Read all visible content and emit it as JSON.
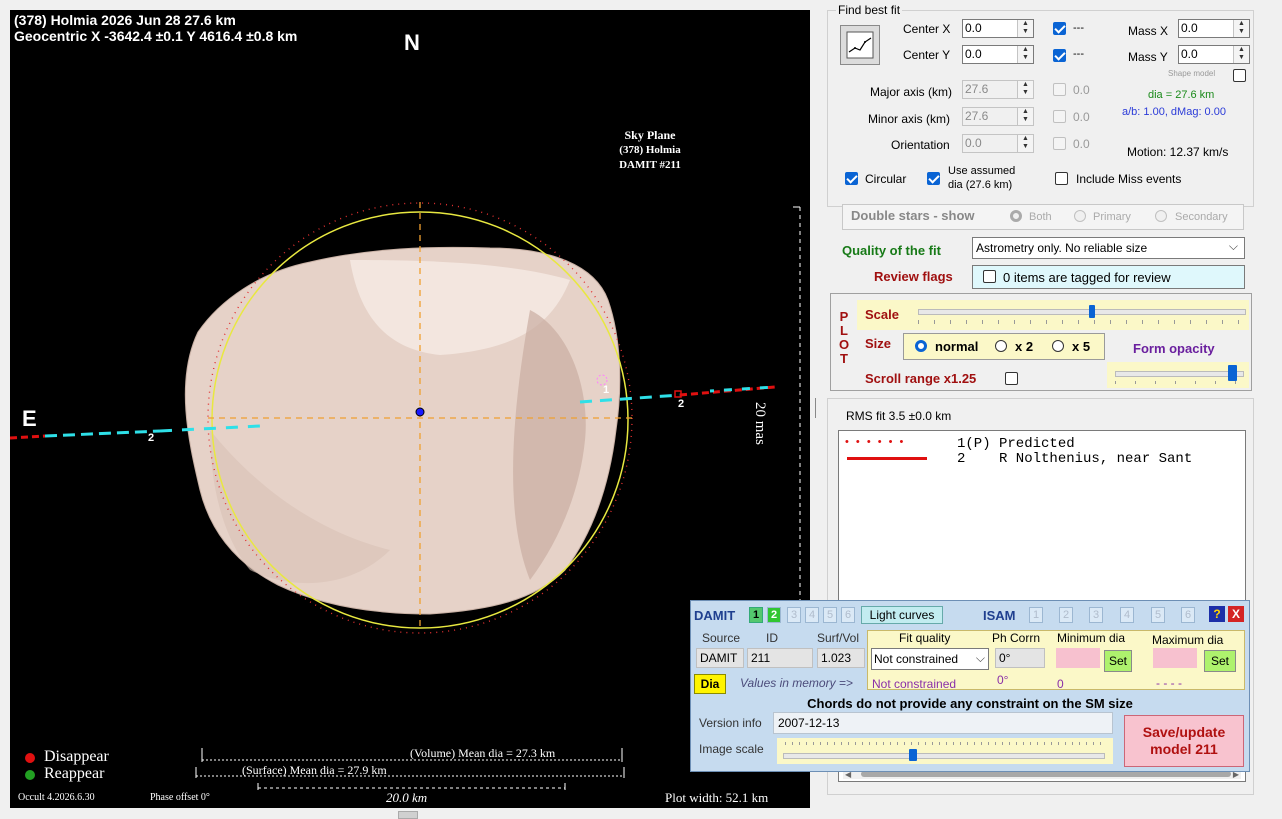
{
  "plot": {
    "title_line1": "(378) Holmia  2026 Jun 28   27.6 km",
    "title_line2": "Geocentric X -3642.4 ±0.1  Y 4616.4 ±0.8 km",
    "north": "N",
    "east": "E",
    "sky_plane": "Sky Plane",
    "sky_object": "(378) Holmia",
    "sky_model": "DAMIT #211",
    "scale_label": "20 mas",
    "chord_left_id": "2",
    "chord_right_id": "2",
    "chord_predicted_id": "1",
    "legend_disappear": "Disappear",
    "legend_reappear": "Reappear",
    "volume_dia": "(Volume) Mean dia = 27.3 km",
    "surface_dia": "(Surface) Mean dia = 27.9 km",
    "scale_bar": "20.0 km",
    "version": "Occult 4.2026.6.30",
    "phase_offset": "Phase offset 0°",
    "plot_width": "Plot width: 52.1 km",
    "colors": {
      "disappear": "#e01010",
      "reappear": "#22a022",
      "ellipse": "#e8e840",
      "chord_red": "#e01010",
      "chord_cyan": "#2ee0e8"
    }
  },
  "fit": {
    "group_title": "Find best fit",
    "center_x_label": "Center X",
    "center_x_value": "0.0",
    "center_y_label": "Center Y",
    "center_y_value": "0.0",
    "fix_dash_x": "---",
    "fix_dash_y": "---",
    "mass_x_label": "Mass X",
    "mass_x_value": "0.0",
    "mass_y_label": "Mass Y",
    "mass_y_value": "0.0",
    "shape_model_label": "Shape model",
    "major_label": "Major axis (km)",
    "major_value": "27.6",
    "major_fit": "0.0",
    "minor_label": "Minor axis (km)",
    "minor_value": "27.6",
    "minor_fit": "0.0",
    "orient_label": "Orientation",
    "orient_value": "0.0",
    "orient_fit": "0.0",
    "dia_text": "dia = 27.6 km",
    "ab_text": "a/b: 1.00, dMag: 0.00",
    "motion_text": "Motion: 12.37 km/s",
    "circular_label": "Circular",
    "use_assumed_label": "Use assumed",
    "use_assumed_sub": "dia (27.6 km)",
    "include_miss_label": "Include Miss events",
    "double_stars_label": "Double stars - show",
    "both_label": "Both",
    "primary_label": "Primary",
    "secondary_label": "Secondary",
    "quality_label": "Quality of the fit",
    "quality_value": "Astrometry only. No reliable size",
    "review_label": "Review flags",
    "review_value": "0 items are tagged for review"
  },
  "plotctl": {
    "plot_letters": [
      "P",
      "L",
      "O",
      "T"
    ],
    "scale_label": "Scale",
    "size_label": "Size",
    "normal_label": "normal",
    "x2_label": "x 2",
    "x5_label": "x 5",
    "form_opacity_label": "Form opacity",
    "scroll_range_label": "Scroll range x1.25",
    "scale_fraction": 0.53,
    "opacity_fraction": 0.95
  },
  "results": {
    "rms_text": "RMS fit 3.5 ±0.0 km",
    "list": [
      {
        "symbol": "• • • • • •",
        "text": "1(P) Predicted"
      },
      {
        "symbol": "",
        "text": "2    R Nolthenius, near Sant"
      }
    ]
  },
  "damit": {
    "title": "DAMIT",
    "tabs": [
      "1",
      "2",
      "3",
      "4",
      "5",
      "6"
    ],
    "light_curves_label": "Light curves",
    "isam_title": "ISAM",
    "isam_tabs": [
      "1",
      "2",
      "3",
      "4",
      "5",
      "6"
    ],
    "help_label": "?",
    "close_label": "X",
    "source_header": "Source",
    "id_header": "ID",
    "surfvol_header": "Surf/Vol",
    "fit_quality_header": "Fit quality",
    "phcorr_header": "Ph Corrn",
    "min_dia_header": "Minimum dia",
    "max_dia_header": "Maximum dia",
    "source_value": "DAMIT",
    "id_value": "211",
    "surfvol_value": "1.023",
    "fit_quality_value": "Not constrained",
    "phcorr_value": "0°",
    "set_label": "Set",
    "dia_button": "Dia",
    "values_in_memory": "Values in memory =>",
    "mem_fit_quality": "Not constrained",
    "mem_phcorr": "0°",
    "mem_min_dia": "0",
    "mem_max_dia": "- - - -",
    "chords_note": "Chords do not provide any constraint on the SM size",
    "version_label": "Version info",
    "version_value": "2007-12-13",
    "image_scale_label": "Image scale",
    "image_scale_fraction": 0.4,
    "save_label_1": "Save/update",
    "save_label_2": "model 211"
  }
}
